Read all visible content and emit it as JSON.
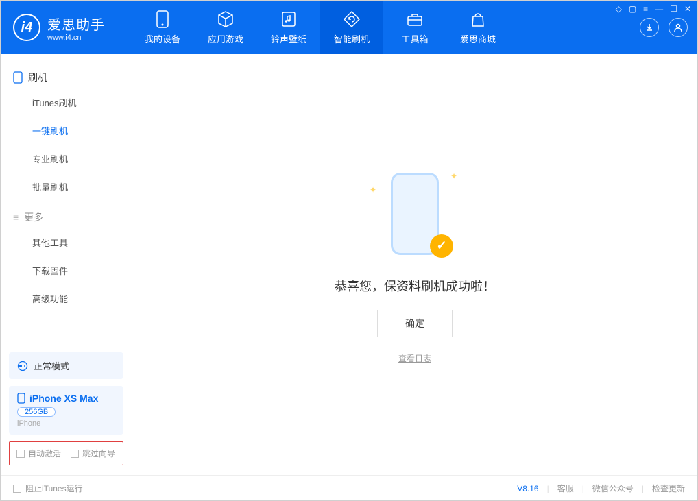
{
  "app": {
    "title": "爱思助手",
    "subtitle": "www.i4.cn"
  },
  "tabs": {
    "device": "我的设备",
    "apps": "应用游戏",
    "ring": "铃声壁纸",
    "flash": "智能刷机",
    "tools": "工具箱",
    "store": "爱思商城"
  },
  "sidebar": {
    "section1": "刷机",
    "items1": [
      "iTunes刷机",
      "一键刷机",
      "专业刷机",
      "批量刷机"
    ],
    "section2": "更多",
    "items2": [
      "其他工具",
      "下载固件",
      "高级功能"
    ]
  },
  "mode": {
    "label": "正常模式"
  },
  "device": {
    "name": "iPhone XS Max",
    "capacity": "256GB",
    "type": "iPhone"
  },
  "checks": {
    "auto_activate": "自动激活",
    "skip_guide": "跳过向导"
  },
  "main": {
    "message": "恭喜您，保资料刷机成功啦！",
    "ok": "确定",
    "log": "查看日志"
  },
  "footer": {
    "block_itunes": "阻止iTunes运行",
    "version": "V8.16",
    "support": "客服",
    "wechat": "微信公众号",
    "update": "检查更新"
  }
}
